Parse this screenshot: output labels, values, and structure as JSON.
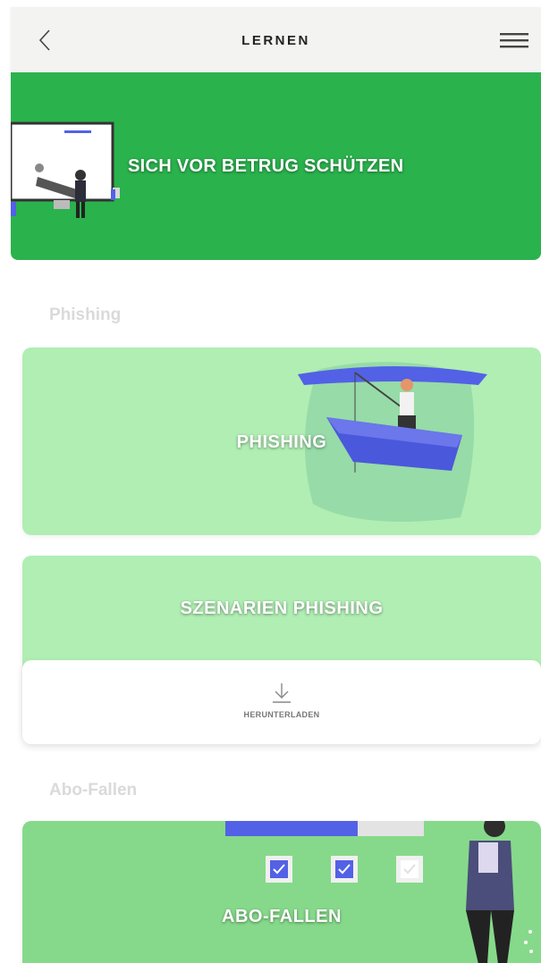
{
  "header": {
    "title": "LERNEN",
    "back_icon": "chevron-left-icon",
    "menu_icon": "hamburger-menu-icon"
  },
  "hero": {
    "title": "SICH VOR BETRUG SCHÜTZEN",
    "color": "#2ab24d"
  },
  "sections": [
    {
      "heading": "Phishing",
      "cards": [
        {
          "title": "PHISHING",
          "color": "#b0eeb3"
        },
        {
          "title": "SZENARIEN PHISHING",
          "color": "#b0eeb3",
          "download_label": "HERUNTERLADEN",
          "download_icon": "download-icon"
        }
      ]
    },
    {
      "heading": "Abo-Fallen",
      "cards": [
        {
          "title": "ABO-FALLEN",
          "color": "#86d98a"
        }
      ]
    }
  ],
  "colors": {
    "accent_green": "#2ab24d",
    "light_green": "#b0eeb3",
    "mid_green": "#86d98a",
    "illustration_blue": "#5361e6"
  }
}
